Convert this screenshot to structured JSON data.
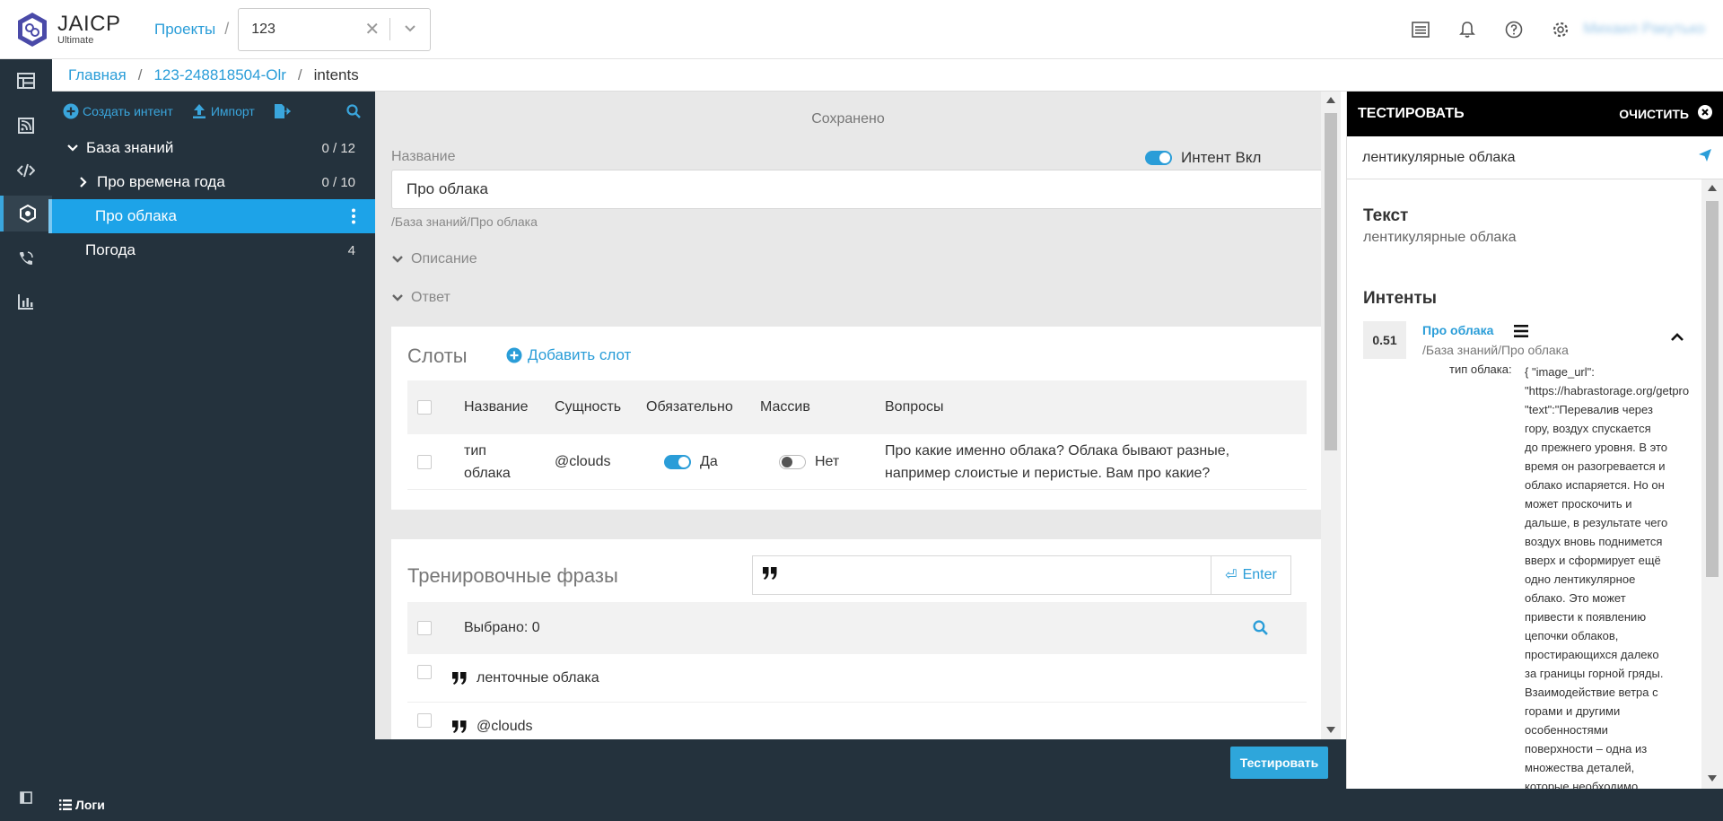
{
  "header": {
    "logo_main": "JAICP",
    "logo_sub": "Ultimate",
    "projects_link": "Проекты",
    "separator": "/",
    "project_select_value": "123",
    "user_name": "Михаил Ракутько"
  },
  "breadcrumb": {
    "home": "Главная",
    "project": "123-248818504-Olr",
    "current": "intents",
    "separator": "/"
  },
  "tree_toolbar": {
    "create_intent": "Создать интент",
    "import": "Импорт"
  },
  "tree": {
    "items": [
      {
        "label": "База знаний",
        "count": "0 / 12",
        "expanded": true
      },
      {
        "label": "Про времена года",
        "count": "0 / 10",
        "expanded": false
      },
      {
        "label": "Про облака",
        "count": "",
        "selected": true
      },
      {
        "label": "Погода",
        "count": "4"
      }
    ]
  },
  "logs_label": "Логи",
  "editor": {
    "status": "Сохранено",
    "name_label": "Название",
    "intent_toggle_label": "Интент Вкл",
    "name_value": "Про облака",
    "path": "/База знаний/Про облака",
    "description_label": "Описание",
    "answer_label": "Ответ",
    "slots": {
      "title": "Слоты",
      "add_slot": "Добавить слот",
      "columns": [
        "Название",
        "Сущность",
        "Обязательно",
        "Массив",
        "Вопросы"
      ],
      "rows": [
        {
          "name_line1": "тип",
          "name_line2": "облака",
          "entity": "@clouds",
          "required": "Да",
          "array": "Нет",
          "question_line1": "Про какие именно облака? Облака бывают разные,",
          "question_line2": "например слоистые и перистые. Вам про какие?"
        }
      ]
    },
    "phrases": {
      "title": "Тренировочные фразы",
      "enter_button": "Enter",
      "selected_label": "Выбрано: 0",
      "items": [
        "ленточные облака",
        "@clouds"
      ]
    },
    "test_button": "Тестировать"
  },
  "test_panel": {
    "title": "ТЕСТИРОВАТЬ",
    "clear": "ОЧИСТИТЬ",
    "input_value": "лентикулярные облака",
    "text_section": "Текст",
    "text_value": "лентикулярные облака",
    "intents_section": "Интенты",
    "intent": {
      "score": "0.51",
      "name": "Про облака",
      "path": "/База знаний/Про облака",
      "slot_label": "тип облака:",
      "slot_lines": [
        "{ \"image_url\":",
        "\"https://habrastorage.org/getpro",
        "\"text\":\"Перевалив через",
        "гору, воздух спускается",
        "до прежнего уровня. В это",
        "время он разогревается и",
        "облако испаряется. Но он",
        "может проскочить и",
        "дальше, в результате чего",
        "воздух вновь поднимется",
        "вверх и сформирует ещё",
        "одно лентикулярное",
        "облако. Это может",
        "привести к появлению",
        "цепочки облаков,",
        "простирающихся далеко",
        "за границы горной гряды.",
        "Взаимодействие ветра с",
        "горами и другими",
        "особенностями",
        "поверхности – одна из",
        "множества деталей,",
        "которые необходимо"
      ]
    }
  },
  "colors": {
    "accent": "#2a9dd8",
    "dark": "#24323d",
    "selected": "#1da3e8"
  }
}
